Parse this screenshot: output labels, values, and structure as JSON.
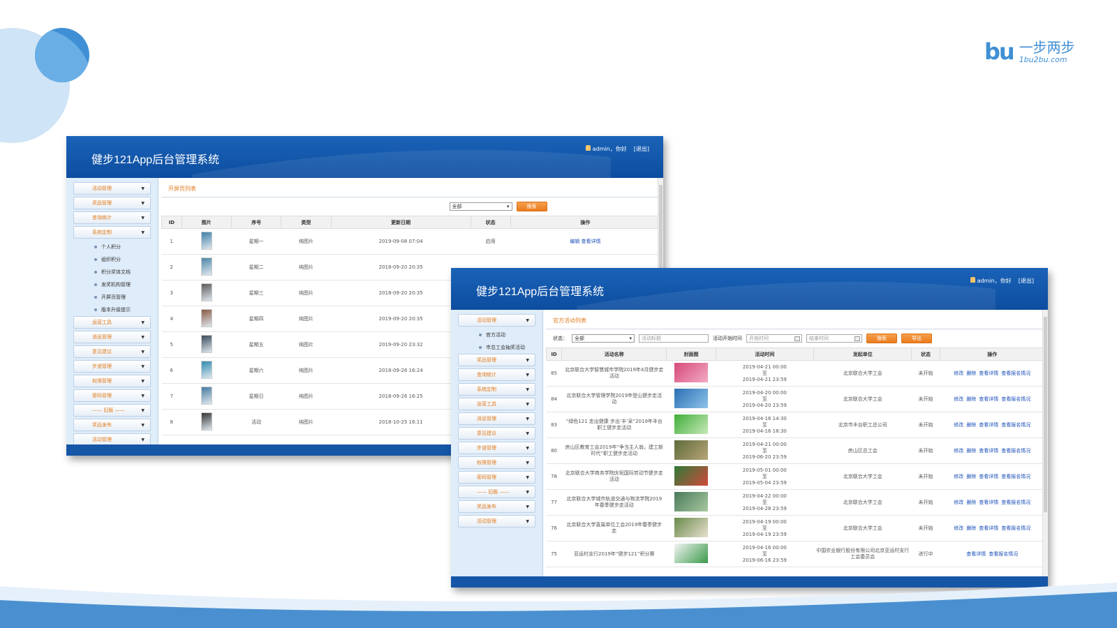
{
  "logo": {
    "mark": "bu",
    "cn": "一步两步",
    "en": "1bu2bu.com"
  },
  "app_title": "健步121App后台管理系统",
  "user": {
    "name": "admin，你好",
    "logout": "[退出]"
  },
  "win1": {
    "sidebar": [
      {
        "type": "menu",
        "label": "活动管理"
      },
      {
        "type": "menu",
        "label": "奖品管理"
      },
      {
        "type": "menu",
        "label": "查询统计"
      },
      {
        "type": "menu",
        "label": "系统定制"
      },
      {
        "type": "sub",
        "label": "个人积分"
      },
      {
        "type": "sub",
        "label": "组织积分"
      },
      {
        "type": "sub",
        "label": "积分奖体文档"
      },
      {
        "type": "sub",
        "label": "发奖机构管理"
      },
      {
        "type": "sub",
        "label": "开屏页管理"
      },
      {
        "type": "sub",
        "label": "版本升级提示"
      },
      {
        "type": "menu",
        "label": "运营工具"
      },
      {
        "type": "menu",
        "label": "消息管理"
      },
      {
        "type": "menu",
        "label": "意见建议"
      },
      {
        "type": "menu",
        "label": "步道管理"
      },
      {
        "type": "menu",
        "label": "权限管理"
      },
      {
        "type": "menu",
        "label": "密码管理"
      },
      {
        "type": "menu",
        "label": "—— 旧版 ——"
      },
      {
        "type": "menu",
        "label": "奖品发布"
      },
      {
        "type": "menu",
        "label": "活动管理"
      }
    ],
    "crumb": "开屏页列表",
    "filter_select": "全部",
    "search_btn": "搜索",
    "headers": [
      "ID",
      "图片",
      "序号",
      "类型",
      "更新日期",
      "状态",
      "操作"
    ],
    "rows": [
      {
        "id": "1",
        "seq": "星期一",
        "type": "纯图片",
        "date": "2019-09-08 07:04",
        "status": "启用",
        "ops": "编辑 查看详情",
        "color": "#3f7fa8"
      },
      {
        "id": "2",
        "seq": "星期二",
        "type": "纯图片",
        "date": "2018-09-20 20:35",
        "status": "",
        "ops": "",
        "color": "#4d86a8"
      },
      {
        "id": "3",
        "seq": "星期三",
        "type": "纯图片",
        "date": "2018-09-20 20:35",
        "status": "",
        "ops": "",
        "color": "#5b5b5b"
      },
      {
        "id": "4",
        "seq": "星期四",
        "type": "纯图片",
        "date": "2019-09-20 20:35",
        "status": "",
        "ops": "",
        "color": "#8a5a44"
      },
      {
        "id": "5",
        "seq": "星期五",
        "type": "纯图片",
        "date": "2019-09-20 23:32",
        "status": "",
        "ops": "",
        "color": "#3a4a5a"
      },
      {
        "id": "6",
        "seq": "星期六",
        "type": "纯图片",
        "date": "2018-09-26 16:24",
        "status": "",
        "ops": "",
        "color": "#2f8ab0"
      },
      {
        "id": "7",
        "seq": "星期日",
        "type": "纯图片",
        "date": "2018-09-26 16:25",
        "status": "",
        "ops": "",
        "color": "#467aa0"
      },
      {
        "id": "8",
        "seq": "活动",
        "type": "纯图片",
        "date": "2018-10-25 16:11",
        "status": "",
        "ops": "",
        "color": "#333333"
      }
    ]
  },
  "win2": {
    "sidebar": [
      {
        "type": "menu",
        "label": "活动管理"
      },
      {
        "type": "sub",
        "label": "官方活动"
      },
      {
        "type": "sub",
        "label": "市总工会抽奖活动"
      },
      {
        "type": "menu",
        "label": "奖品管理"
      },
      {
        "type": "menu",
        "label": "查询统计"
      },
      {
        "type": "menu",
        "label": "系统定制"
      },
      {
        "type": "menu",
        "label": "运营工具"
      },
      {
        "type": "menu",
        "label": "消息管理"
      },
      {
        "type": "menu",
        "label": "意见建议"
      },
      {
        "type": "menu",
        "label": "步道管理"
      },
      {
        "type": "menu",
        "label": "权限管理"
      },
      {
        "type": "menu",
        "label": "密码管理"
      },
      {
        "type": "menu",
        "label": "—— 旧版 ——"
      },
      {
        "type": "menu",
        "label": "奖品发布"
      },
      {
        "type": "menu",
        "label": "活动管理"
      }
    ],
    "crumb": "官方活动列表",
    "filter": {
      "status_label": "状态：",
      "status_value": "全部",
      "title_placeholder": "活动标题",
      "time_label": "活动开始时间",
      "start_placeholder": "开始时间",
      "end_placeholder": "结束时间",
      "search_btn": "搜索",
      "export_btn": "导出"
    },
    "headers": [
      "ID",
      "活动名称",
      "封面图",
      "活动时间",
      "发起单位",
      "状态",
      "操作"
    ],
    "rows": [
      {
        "id": "85",
        "name": "北京联合大学智慧城市学院2019年4月健步走活动",
        "t1": "2019-04-21 00:00",
        "t2": "2019-04-21 23:59",
        "unit": "北京联合大学工会",
        "status": "未开始",
        "ops": [
          "修改",
          "删除",
          "查看详情",
          "查看报名情况"
        ],
        "c1": "#d64a7a",
        "c2": "#f2a9c4"
      },
      {
        "id": "84",
        "name": "北京联合大学管理学院2019年登山健步走活动",
        "t1": "2019-04-20 00:00",
        "t2": "2019-04-20 23:59",
        "unit": "北京联合大学工会",
        "status": "未开始",
        "ops": [
          "修改",
          "删除",
          "查看详情",
          "查看报名情况"
        ],
        "c1": "#2a6fb5",
        "c2": "#8fc3e8"
      },
      {
        "id": "83",
        "name": "“绿色121 走出健康 步出‘丰’采”2019年丰台职工健步走活动",
        "t1": "2019-04-16 14:30",
        "t2": "2019-04-16 18:30",
        "unit": "北京市丰台职工总公司",
        "status": "未开始",
        "ops": [
          "修改",
          "删除",
          "查看详情",
          "查看报名情况"
        ],
        "c1": "#3fae3a",
        "c2": "#c9e8b8"
      },
      {
        "id": "80",
        "name": "房山区教育工会2019年“争当主人翁，建工新时代”职工健步走活动",
        "t1": "2019-04-21 00:00",
        "t2": "2019-06-20 23:59",
        "unit": "房山区总工会",
        "status": "未开始",
        "ops": [
          "修改",
          "删除",
          "查看详情",
          "查看报名情况"
        ],
        "c1": "#5c6b3a",
        "c2": "#b8a478"
      },
      {
        "id": "78",
        "name": "北京联合大学商务学院庆祝国际劳动节健步走活动",
        "t1": "2019-05-01 00:00",
        "t2": "2019-05-04 23:59",
        "unit": "北京联合大学工会",
        "status": "未开始",
        "ops": [
          "修改",
          "删除",
          "查看详情",
          "查看报名情况"
        ],
        "c1": "#2f7a3a",
        "c2": "#d14a3a"
      },
      {
        "id": "77",
        "name": "北京联合大学城市轨道交通与物流学院2019年春季健步走活动",
        "t1": "2019-04-22 00:00",
        "t2": "2019-04-28 23:59",
        "unit": "北京联合大学工会",
        "status": "未开始",
        "ops": [
          "修改",
          "删除",
          "查看详情",
          "查看报名情况"
        ],
        "c1": "#4a7a5a",
        "c2": "#a8c8a0"
      },
      {
        "id": "76",
        "name": "北京联合大学直属单位工会2019年春季健步走",
        "t1": "2019-04-19 00:00",
        "t2": "2019-04-19 23:59",
        "unit": "北京联合大学工会",
        "status": "未开始",
        "ops": [
          "修改",
          "删除",
          "查看详情",
          "查看报名情况"
        ],
        "c1": "#6a8a4a",
        "c2": "#e8e0d0"
      },
      {
        "id": "75",
        "name": "亚运村支行2019年“健步121”积分赛",
        "t1": "2019-04-16 00:00",
        "t2": "2019-06-16 23:59",
        "unit": "中国农业银行股份有限公司北京亚运村支行工会委员会",
        "status": "进行中",
        "ops": [
          "查看详情",
          "查看报名情况"
        ],
        "c1": "#f4f4f4",
        "c2": "#3a9a4a"
      }
    ],
    "between": "至"
  },
  "colors": {
    "accent": "#3f8fd4",
    "header": "#0d4d9f",
    "orange": "#e07a1c",
    "link": "#1a4fb8"
  }
}
